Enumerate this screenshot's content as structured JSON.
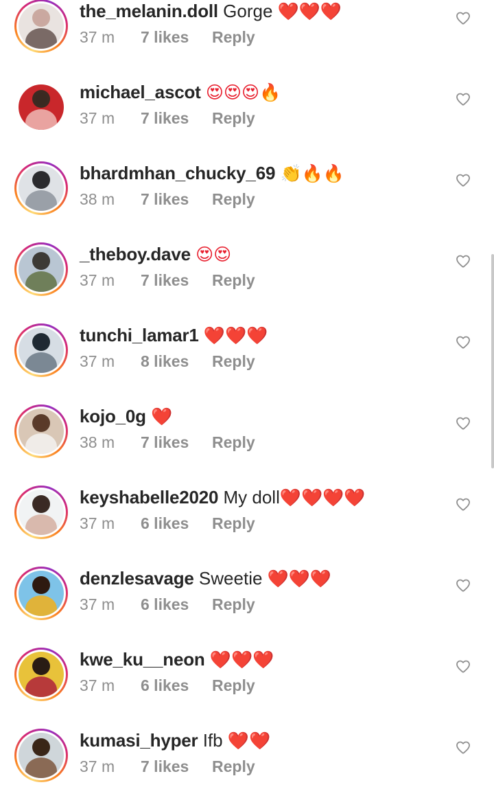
{
  "comments": [
    {
      "username": "the_melanin.doll",
      "text": " Gorge ",
      "emoji": "❤️❤️❤️",
      "time": "37 m",
      "likes": "7 likes",
      "reply": "Reply",
      "avatar_colors": [
        "#e9e3e0",
        "#caa9a0",
        "#7a6a66"
      ]
    },
    {
      "username": "michael_ascot",
      "text": " ",
      "emoji": "😍😍😍🔥",
      "time": "37 m",
      "likes": "7 likes",
      "reply": "Reply",
      "avatar_colors": [
        "#c9272b",
        "#3b2a22",
        "#e9a3a0"
      ]
    },
    {
      "username": "bhardmhan_chucky_69",
      "text": " ",
      "emoji": "👏🔥🔥",
      "time": "38 m",
      "likes": "7 likes",
      "reply": "Reply",
      "avatar_colors": [
        "#dfe2e6",
        "#2b2b2e",
        "#9aa0a8"
      ]
    },
    {
      "username": "_theboy.dave",
      "text": " ",
      "emoji": "😍😍",
      "time": "37 m",
      "likes": "7 likes",
      "reply": "Reply",
      "avatar_colors": [
        "#b9c6d3",
        "#3c3a36",
        "#6f7f5a"
      ]
    },
    {
      "username": "tunchi_lamar1",
      "text": " ",
      "emoji": "❤️❤️❤️",
      "time": "37 m",
      "likes": "8 likes",
      "reply": "Reply",
      "avatar_colors": [
        "#d6dde4",
        "#1f2a33",
        "#7b8894"
      ]
    },
    {
      "username": "kojo_0g",
      "text": " ",
      "emoji": "❤️",
      "time": "38 m",
      "likes": "7 likes",
      "reply": "Reply",
      "avatar_colors": [
        "#d9c7b6",
        "#5a3b2a",
        "#f0ece8"
      ]
    },
    {
      "username": "keyshabelle2020",
      "text": " My doll",
      "emoji": "❤️❤️❤️❤️",
      "time": "37 m",
      "likes": "6 likes",
      "reply": "Reply",
      "avatar_colors": [
        "#f1f3f4",
        "#3a2a24",
        "#d9b9ad"
      ]
    },
    {
      "username": "denzlesavage",
      "text": " Sweetie ",
      "emoji": "❤️❤️❤️",
      "time": "37 m",
      "likes": "6 likes",
      "reply": "Reply",
      "avatar_colors": [
        "#7ec3e8",
        "#2e1a10",
        "#e0b33a"
      ]
    },
    {
      "username": "kwe_ku__neon",
      "text": " ",
      "emoji": "❤️❤️❤️",
      "time": "37 m",
      "likes": "6 likes",
      "reply": "Reply",
      "avatar_colors": [
        "#e8c23a",
        "#2a1c14",
        "#b73a3a"
      ]
    },
    {
      "username": "kumasi_hyper",
      "text": " Ifb ",
      "emoji": "❤️❤️",
      "time": "37 m",
      "likes": "7 likes",
      "reply": "Reply",
      "avatar_colors": [
        "#cfd6da",
        "#3a2618",
        "#8a6a55"
      ]
    }
  ],
  "colors": {
    "heart_emoji": "#e8202f",
    "meta_gray": "#8e8e8e",
    "text_dark": "#262626",
    "heart_icon": "#8e8e8e"
  },
  "icons": {
    "like": "heart-outline-icon"
  }
}
